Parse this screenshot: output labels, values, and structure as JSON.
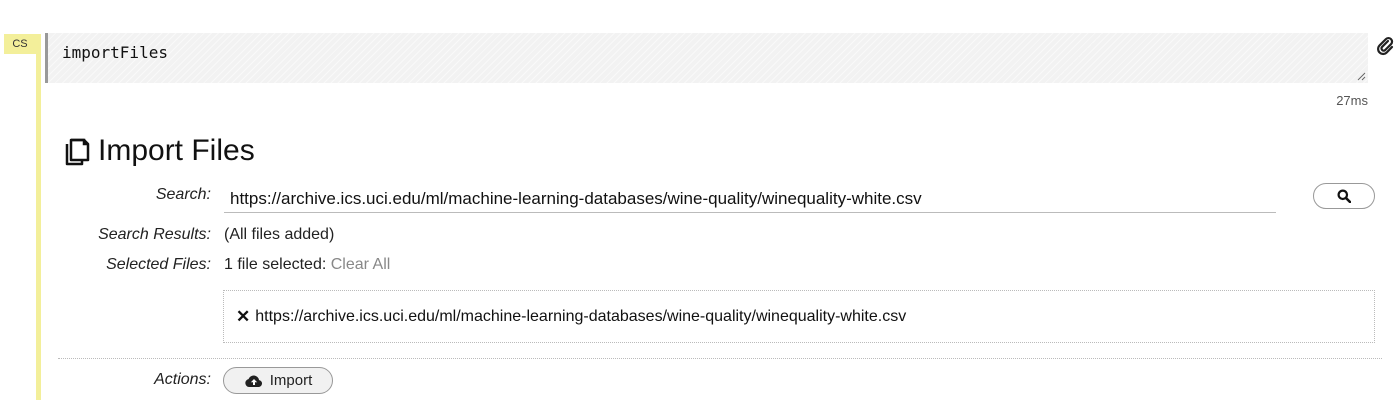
{
  "cell": {
    "type_badge": "CS",
    "code": "importFiles",
    "timing": "27ms"
  },
  "panel": {
    "title": "Import Files",
    "search": {
      "label": "Search:",
      "value": "https://archive.ics.uci.edu/ml/machine-learning-databases/wine-quality/winequality-white.csv"
    },
    "search_results": {
      "label": "Search Results:",
      "value": "(All files added)"
    },
    "selected_files": {
      "label": "Selected Files:",
      "count_text": "1 file selected:",
      "clear_label": "Clear All",
      "files": [
        "https://archive.ics.uci.edu/ml/machine-learning-databases/wine-quality/winequality-white.csv"
      ]
    },
    "actions": {
      "label": "Actions:",
      "import_label": "Import"
    }
  },
  "icons": {
    "attach": "paperclip-icon",
    "title": "copy-files-icon",
    "search": "search-icon",
    "remove": "remove-x-icon",
    "import": "cloud-upload-icon"
  },
  "colors": {
    "cell_gutter": "#f3ef9a",
    "muted_link": "#888888"
  }
}
